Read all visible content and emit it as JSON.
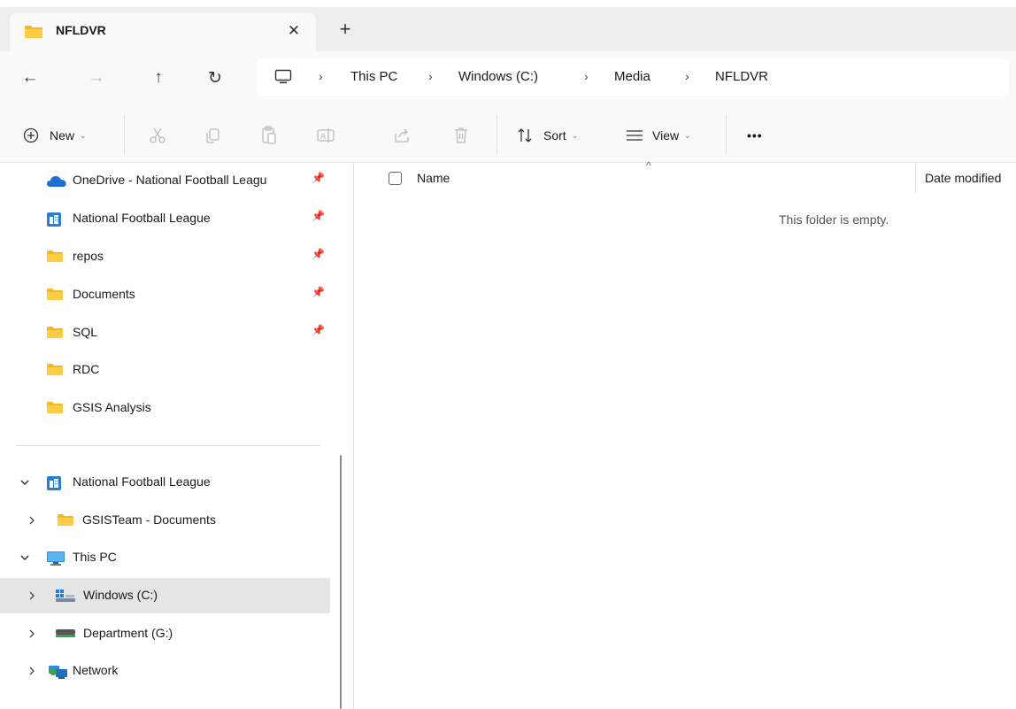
{
  "tab": {
    "title": "NFLDVR",
    "close_glyph": "✕",
    "new_tab_glyph": "+"
  },
  "nav": {
    "back_glyph": "←",
    "forward_glyph": "→",
    "up_glyph": "↑",
    "refresh_glyph": "↻",
    "breadcrumb": [
      "This PC",
      "Windows (C:)",
      "Media",
      "NFLDVR"
    ],
    "separator": "›"
  },
  "commands": {
    "new_label": "New",
    "sort_label": "Sort",
    "view_label": "View",
    "more_glyph": "•••",
    "chevron": "⌄"
  },
  "sidebar": {
    "quick_access": [
      {
        "label": "OneDrive - National Football Leagu",
        "icon": "onedrive-cloud-icon",
        "pinned": true
      },
      {
        "label": "National Football League",
        "icon": "sharepoint-org-icon",
        "pinned": true
      },
      {
        "label": "repos",
        "icon": "folder-icon",
        "pinned": true
      },
      {
        "label": "Documents",
        "icon": "folder-icon",
        "pinned": true
      },
      {
        "label": "SQL",
        "icon": "folder-icon",
        "pinned": true
      },
      {
        "label": "RDC",
        "icon": "folder-icon",
        "pinned": false
      },
      {
        "label": "GSIS Analysis",
        "icon": "folder-icon",
        "pinned": false
      }
    ],
    "tree": [
      {
        "label": "National Football League",
        "icon": "sharepoint-org-icon",
        "expanded": true
      },
      {
        "label": "GSISTeam - Documents",
        "icon": "folder-icon",
        "expanded": false
      },
      {
        "label": "This PC",
        "icon": "monitor-icon",
        "expanded": true
      },
      {
        "label": "Windows (C:)",
        "icon": "windows-drive-icon",
        "expanded": false,
        "selected": true
      },
      {
        "label": "Department (G:)",
        "icon": "network-drive-icon",
        "expanded": false
      },
      {
        "label": "Network",
        "icon": "network-icon",
        "expanded": false
      }
    ],
    "pin_glyph": "📌",
    "expand_open_glyph": "⌄",
    "expand_closed_glyph": "›"
  },
  "content": {
    "col_name": "Name",
    "col_date": "Date modified",
    "empty_message": "This folder is empty.",
    "sort_caret": "^"
  },
  "colors": {
    "folder_yellow": "#f8c233",
    "onedrive_blue": "#1e6fd0",
    "sharepoint_blue": "#2b7cd3",
    "selected_bg": "#e5e5e5"
  }
}
